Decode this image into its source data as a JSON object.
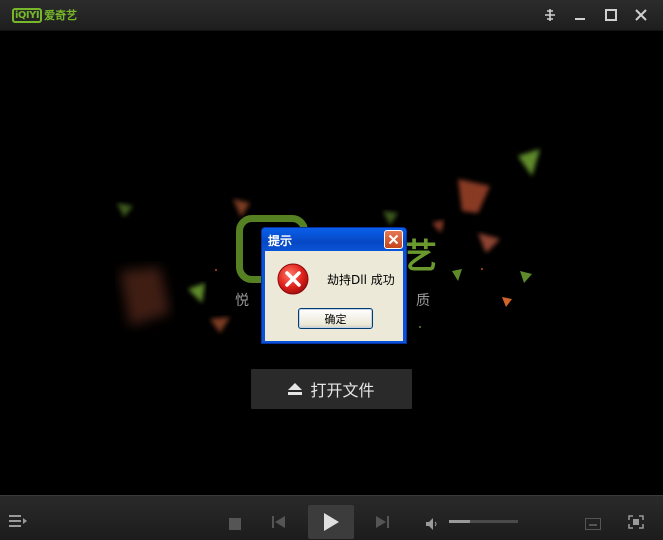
{
  "app": {
    "logo_box": "iQIYI",
    "logo_text": "爱奇艺"
  },
  "titlebar": {
    "icons": [
      "pin-icon",
      "minimize-icon",
      "maximize-icon",
      "close-icon"
    ]
  },
  "stage": {
    "logo_char_right": "艺",
    "slogan_left": "悦",
    "slogan_right": "质",
    "open_file_label": "打开文件"
  },
  "controlbar": {
    "icons": [
      "playlist-icon",
      "stop-icon",
      "prev-icon",
      "play-icon",
      "next-icon",
      "volume-icon",
      "subtitle-icon",
      "fullscreen-icon"
    ],
    "volume_level": 0.3
  },
  "dialog": {
    "title": "提示",
    "message": "劫持Dll 成功",
    "ok_label": "确定"
  },
  "colors": {
    "brand": "#76b82a",
    "xp_title": "#0a52d8",
    "xp_body": "#ece9d8"
  }
}
